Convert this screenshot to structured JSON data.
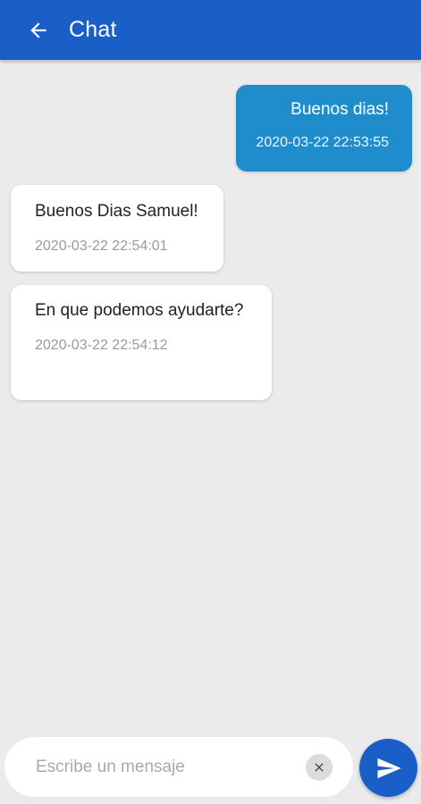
{
  "app": {
    "title": "Chat"
  },
  "colors": {
    "appbar": "#1a5fc8",
    "outgoing_bubble": "#1f8dcc",
    "background": "#ebebeb",
    "send_button": "#1a5fc8"
  },
  "icons": {
    "back": "arrow-left-icon",
    "clear": "close-icon",
    "send": "send-icon"
  },
  "messages": [
    {
      "direction": "outgoing",
      "text": "Buenos dias!",
      "time": "2020-03-22 22:53:55"
    },
    {
      "direction": "incoming",
      "text": "Buenos Dias Samuel!",
      "time": "2020-03-22 22:54:01"
    },
    {
      "direction": "incoming",
      "text": "En que podemos ayudarte?",
      "time": "2020-03-22 22:54:12"
    }
  ],
  "composer": {
    "placeholder": "Escribe un mensaje",
    "value": ""
  }
}
